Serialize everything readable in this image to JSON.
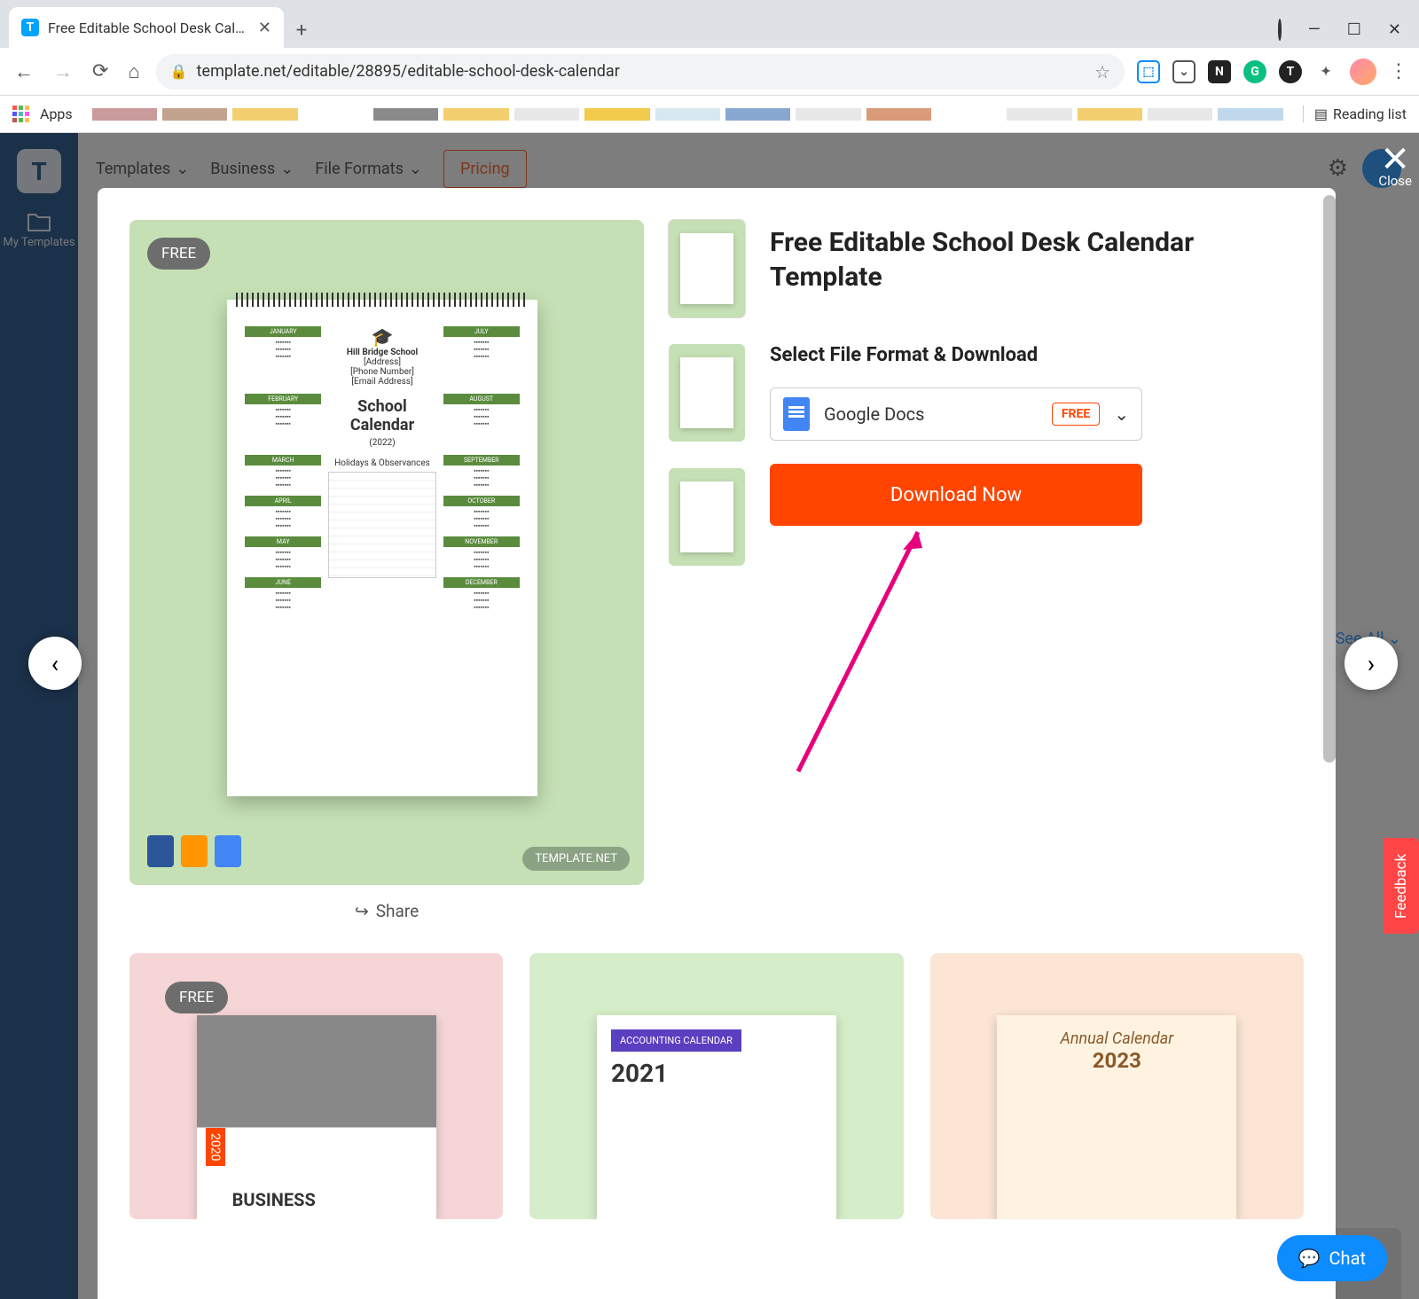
{
  "browser": {
    "tab_title": "Free Editable School Desk Calen",
    "url": "template.net/editable/28895/editable-school-desk-calendar",
    "apps_label": "Apps",
    "reading_list": "Reading list",
    "window": {
      "minimize": "—",
      "maximize": "☐",
      "close": "✕"
    }
  },
  "sidebar": {
    "logo": "T",
    "my_templates": "My Templates"
  },
  "topnav": {
    "templates": "Templates",
    "business": "Business",
    "file_formats": "File Formats",
    "pricing": "Pricing"
  },
  "see_all": "See All",
  "modal": {
    "close_label": "Close",
    "free_badge": "FREE",
    "watermark": "TEMPLATE.NET",
    "title": "Free Editable School Desk Calendar Template",
    "select_label": "Select File Format & Download",
    "format": {
      "name": "Google Docs",
      "free": "FREE"
    },
    "download": "Download Now",
    "share": "Share",
    "calendar": {
      "school": "Hill Bridge School",
      "addr": "[Address]",
      "phone": "[Phone Number]",
      "email": "[Email Address]",
      "title": "School Calendar",
      "year": "(2022)",
      "holidays": "Holidays & Observances"
    }
  },
  "related": {
    "c1_free": "FREE",
    "c1_year": "2020",
    "c1_title": "BUSINESS",
    "c2_title1": "ACCOUNTING CALENDAR",
    "c2_year": "2021",
    "c3_title": "Annual Calendar",
    "c3_year": "2023"
  },
  "bottom_free": "FREE",
  "feedback": "Feedback",
  "chat": "Chat",
  "strip_colors": [
    "#c99b9b",
    "#c2a38e",
    "#f4cf6f",
    "#ffffff",
    "#8a8a8a",
    "#f4cf6f",
    "#e8e8e8",
    "#f2ca4c",
    "#d8e8f0",
    "#88a8d0",
    "#e8e8e8",
    "#d99b7a",
    "#ffffff",
    "#e8e8e8",
    "#f4cf6f",
    "#e8e8e8",
    "#c0d8ec"
  ]
}
